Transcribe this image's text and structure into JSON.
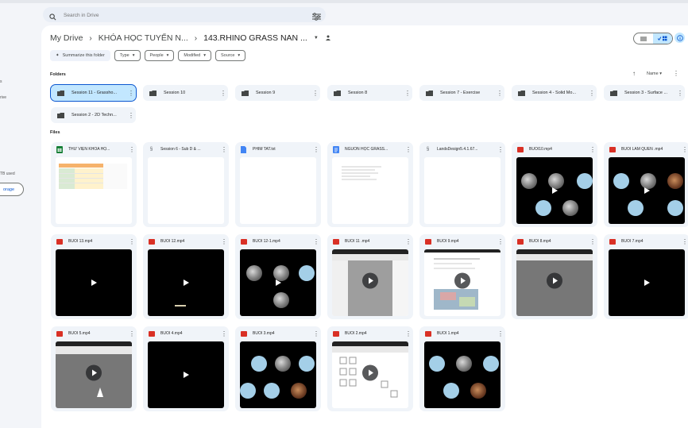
{
  "search": {
    "placeholder": "Search in Drive"
  },
  "sidebar": {
    "storage_text": "TB used",
    "storage_button": "orage",
    "frag1": "s",
    "frag2": "rive"
  },
  "breadcrumb": {
    "root": "My Drive",
    "parent": "KHÓA HỌC TUYỂN N...",
    "current": "143.RHINO GRASS NAN ..."
  },
  "chips": {
    "summarize": "Summarize this folder",
    "type": "Type",
    "people": "People",
    "modified": "Modified",
    "source": "Source"
  },
  "sections": {
    "folders": "Folders",
    "files": "Files"
  },
  "sort": {
    "label": "Name"
  },
  "folders": [
    {
      "name": "Session 11 - Grassho..."
    },
    {
      "name": "Session 10"
    },
    {
      "name": "Session 9"
    },
    {
      "name": "Session 8"
    },
    {
      "name": "Session 7 - Exercise"
    },
    {
      "name": "Session 4 - Solid Mo..."
    },
    {
      "name": "Session 3 - Surface ..."
    },
    {
      "name": "Session 2 - 2D Techn..."
    }
  ],
  "files": [
    {
      "name": "THƯ VIỆN KHÓA HỌ...",
      "type": "sheet-icon"
    },
    {
      "name": "Session 6 - Sub D & ...",
      "type": "shortcut-icon"
    },
    {
      "name": "PHIM TAT.txt",
      "type": "doc-icon"
    },
    {
      "name": "NGUỒN HỌC GRASS...",
      "type": "doc-icon"
    },
    {
      "name": "LandsDesign5.4.1.67...",
      "type": "shortcut-icon"
    },
    {
      "name": "BUOI10.mp4",
      "type": "video-icon"
    },
    {
      "name": "BUOI LAM QUEN .mp4",
      "type": "video-icon"
    },
    {
      "name": "BUOI 13.mp4",
      "type": "video-icon"
    },
    {
      "name": "BUOI 12.mp4",
      "type": "video-icon"
    },
    {
      "name": "BUOI 12-1.mp4",
      "type": "video-icon"
    },
    {
      "name": "BUOI 11 .mp4",
      "type": "video-icon"
    },
    {
      "name": "BUOI 9.mp4",
      "type": "video-icon"
    },
    {
      "name": "BUOI 8.mp4",
      "type": "video-icon"
    },
    {
      "name": "BUOI 7.mp4",
      "type": "video-icon"
    },
    {
      "name": "BUOI 5.mp4",
      "type": "video-icon"
    },
    {
      "name": "BUOI 4.mp4",
      "type": "video-icon"
    },
    {
      "name": "BUOI 3.mp4",
      "type": "video-icon"
    },
    {
      "name": "BUOI 2.mp4",
      "type": "video-icon"
    },
    {
      "name": "BUOI 1.mp4",
      "type": "video-icon"
    }
  ],
  "colors": {
    "accent": "#0b57d0",
    "selected": "#c2e7ff",
    "video": "#d93025",
    "sheet": "#188038",
    "doc": "#4285f4"
  }
}
